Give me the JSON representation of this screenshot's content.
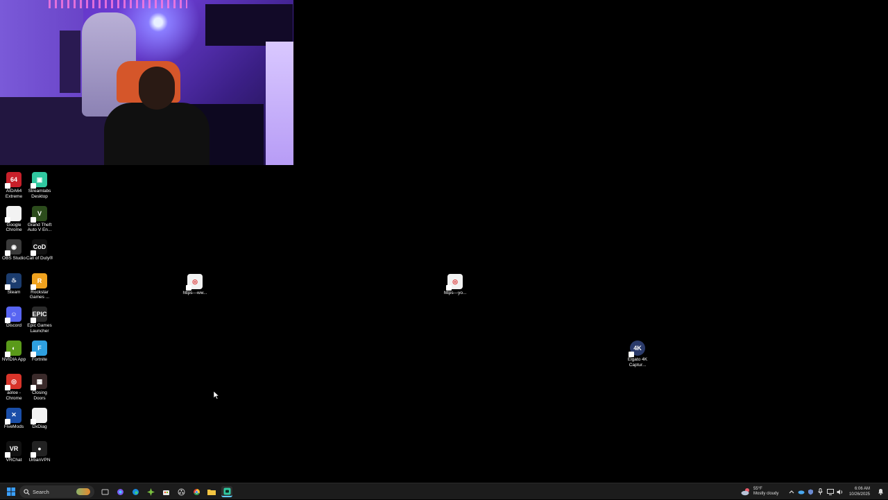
{
  "desktop": {
    "icons": [
      {
        "label": "AIDA64 Extreme",
        "glyph": "64",
        "color": "#c8202a"
      },
      {
        "label": "Streamlabs Desktop",
        "glyph": "▣",
        "color": "#30c8a0"
      },
      {
        "label": "Google Chrome",
        "glyph": "",
        "color": "#f2f2f2"
      },
      {
        "label": "Grand Theft Auto V En...",
        "glyph": "V",
        "color": "#2c4c1c"
      },
      {
        "label": "OBS Studio",
        "glyph": "◉",
        "color": "#3a3a3a"
      },
      {
        "label": "Call of Duty®",
        "glyph": "CoD",
        "color": "#111111"
      },
      {
        "label": "Steam",
        "glyph": "♨",
        "color": "#1b3c6e"
      },
      {
        "label": "Rockstar Games ...",
        "glyph": "R",
        "color": "#f0a21e"
      },
      {
        "label": "Discord",
        "glyph": "☺",
        "color": "#5865f2"
      },
      {
        "label": "Epic Games Launcher",
        "glyph": "EPIC",
        "color": "#2a2a2a"
      },
      {
        "label": "NVIDIA App",
        "glyph": "◐",
        "color": "#5a9a1a"
      },
      {
        "label": "Fortnite",
        "glyph": "F",
        "color": "#2ea0e0"
      },
      {
        "label": "aoloe - Chrome",
        "glyph": "◎",
        "color": "#d8342a"
      },
      {
        "label": "Closing Doors",
        "glyph": "▦",
        "color": "#3a2a2a"
      },
      {
        "label": "FiveMods",
        "glyph": "✕",
        "color": "#1a4ea8"
      },
      {
        "label": "DxDiag",
        "glyph": "",
        "color": "#f2f2f2"
      },
      {
        "label": "VRChat",
        "glyph": "VR",
        "color": "#111111"
      },
      {
        "label": "UrbanVPN",
        "glyph": "●",
        "color": "#222222"
      }
    ],
    "files": [
      {
        "label": "https---ww...",
        "glyph": "◎"
      },
      {
        "label": "https---yo...",
        "glyph": "◎"
      }
    ],
    "elgato": {
      "label": "Elgato 4K Captur...",
      "glyph": "4K"
    }
  },
  "taskbar": {
    "search_label": "Search",
    "weather_temp": "55°F",
    "weather_desc": "Mostly cloudy",
    "time": "6:06 AM",
    "date": "10/26/2025"
  },
  "colors": {
    "desktop_bg": "#000000",
    "taskbar_bg": "#1c1c1c",
    "start_blue": "#3aa0ff"
  }
}
